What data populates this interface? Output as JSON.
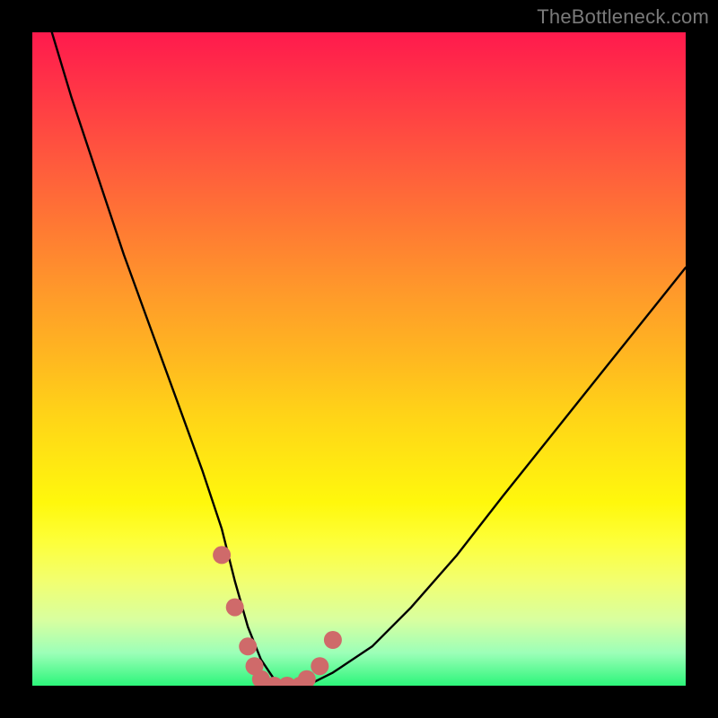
{
  "watermark": "TheBottleneck.com",
  "chart_data": {
    "type": "line",
    "title": "",
    "xlabel": "",
    "ylabel": "",
    "xlim": [
      0,
      100
    ],
    "ylim": [
      0,
      100
    ],
    "series": [
      {
        "name": "bottleneck-curve",
        "x": [
          3,
          6,
          10,
          14,
          18,
          22,
          26,
          29,
          31,
          33,
          35,
          37,
          39,
          42,
          46,
          52,
          58,
          65,
          72,
          80,
          88,
          96,
          100
        ],
        "values": [
          100,
          90,
          78,
          66,
          55,
          44,
          33,
          24,
          16,
          9,
          4,
          1,
          0,
          0,
          2,
          6,
          12,
          20,
          29,
          39,
          49,
          59,
          64
        ]
      }
    ],
    "marker_points": {
      "name": "highlight-dots",
      "color": "#cf6a6a",
      "x": [
        29,
        31,
        33,
        34,
        35,
        37,
        39,
        41,
        42,
        44,
        46
      ],
      "values": [
        20,
        12,
        6,
        3,
        1,
        0,
        0,
        0,
        1,
        3,
        7
      ]
    }
  }
}
